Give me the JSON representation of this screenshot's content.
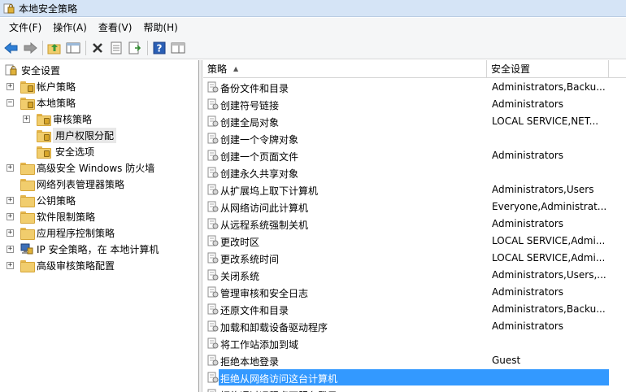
{
  "window": {
    "title": "本地安全策略"
  },
  "menu": [
    "文件(F)",
    "操作(A)",
    "查看(V)",
    "帮助(H)"
  ],
  "toolbar": {
    "buttons": [
      "back-icon",
      "forward-icon",
      "up-folder-icon",
      "show-hide-tree-icon",
      "delete-icon",
      "properties-icon",
      "export-list-icon",
      "help-icon",
      "console-tree-icon"
    ]
  },
  "tree": {
    "root": "安全设置",
    "items": [
      "帐户策略",
      "本地策略",
      "审核策略",
      "用户权限分配",
      "安全选项",
      "高级安全 Windows 防火墙",
      "网络列表管理器策略",
      "公钥策略",
      "软件限制策略",
      "应用程序控制策略",
      "IP 安全策略，在 本地计算机",
      "高级审核策略配置"
    ]
  },
  "list": {
    "columns": [
      "策略",
      "安全设置"
    ],
    "rows": [
      {
        "policy": "备份文件和目录",
        "setting": "Administrators,Backu..."
      },
      {
        "policy": "创建符号链接",
        "setting": "Administrators"
      },
      {
        "policy": "创建全局对象",
        "setting": "LOCAL SERVICE,NET..."
      },
      {
        "policy": "创建一个令牌对象",
        "setting": ""
      },
      {
        "policy": "创建一个页面文件",
        "setting": "Administrators"
      },
      {
        "policy": "创建永久共享对象",
        "setting": ""
      },
      {
        "policy": "从扩展坞上取下计算机",
        "setting": "Administrators,Users"
      },
      {
        "policy": "从网络访问此计算机",
        "setting": "Everyone,Administrat..."
      },
      {
        "policy": "从远程系统强制关机",
        "setting": "Administrators"
      },
      {
        "policy": "更改时区",
        "setting": "LOCAL SERVICE,Admi..."
      },
      {
        "policy": "更改系统时间",
        "setting": "LOCAL SERVICE,Admi..."
      },
      {
        "policy": "关闭系统",
        "setting": "Administrators,Users,..."
      },
      {
        "policy": "管理审核和安全日志",
        "setting": "Administrators"
      },
      {
        "policy": "还原文件和目录",
        "setting": "Administrators,Backu..."
      },
      {
        "policy": "加载和卸载设备驱动程序",
        "setting": "Administrators"
      },
      {
        "policy": "将工作站添加到域",
        "setting": ""
      },
      {
        "policy": "拒绝本地登录",
        "setting": "Guest"
      },
      {
        "policy": "拒绝从网络访问这台计算机",
        "setting": ""
      },
      {
        "policy": "拒绝通过远程桌面服务登录",
        "setting": ""
      }
    ]
  }
}
